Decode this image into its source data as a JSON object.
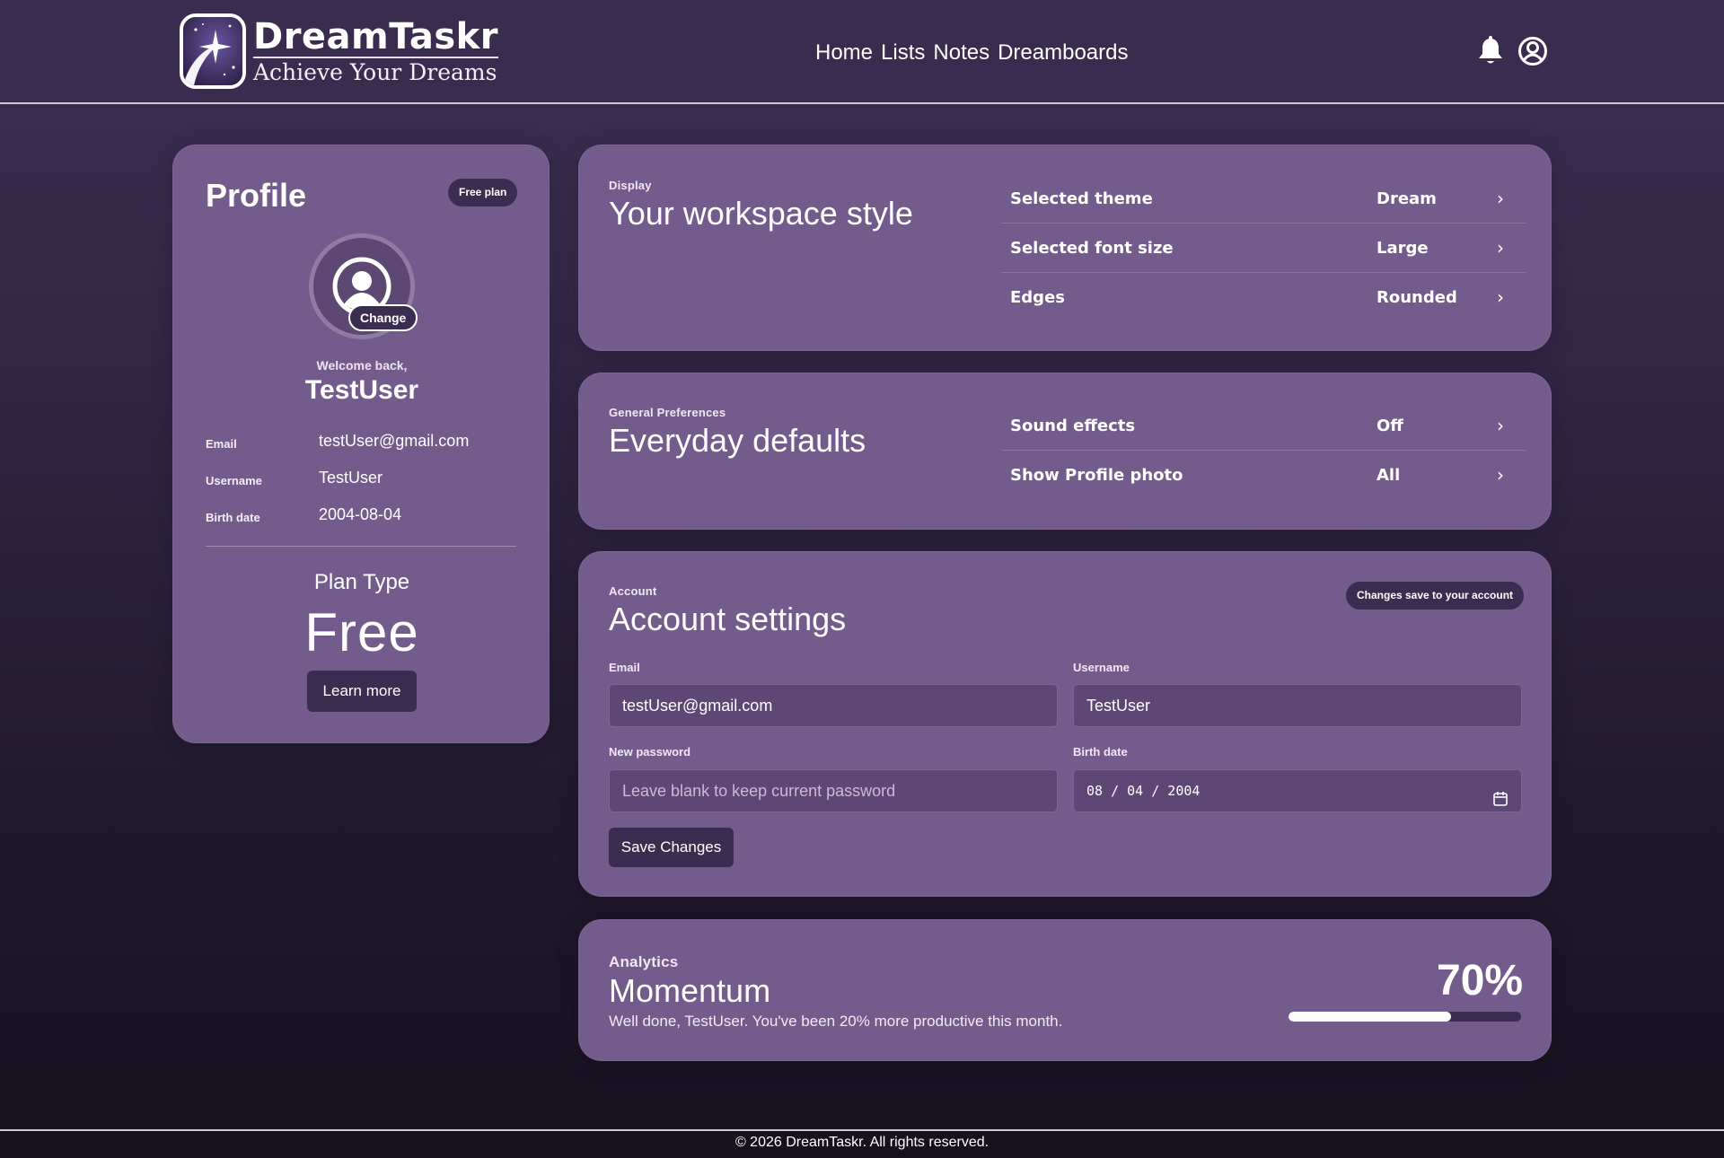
{
  "brand": {
    "name": "DreamTaskr",
    "tagline": "Achieve Your Dreams"
  },
  "nav": {
    "items": [
      "Home",
      "Lists",
      "Notes",
      "Dreamboards"
    ]
  },
  "header_icons": [
    "bell-icon",
    "user-circle-icon"
  ],
  "profile": {
    "heading": "Profile",
    "plan_badge": "Free plan",
    "change_label": "Change",
    "welcome": "Welcome back,",
    "username": "TestUser",
    "fields": [
      {
        "label": "Email",
        "value": "testUser@gmail.com"
      },
      {
        "label": "Username",
        "value": "TestUser"
      },
      {
        "label": "Birth date",
        "value": "2004-08-04"
      }
    ],
    "plan_label": "Plan Type",
    "plan_value": "Free",
    "learn_more": "Learn more"
  },
  "display": {
    "eyebrow": "Display",
    "title": "Your workspace style",
    "rows": [
      {
        "name": "Selected theme",
        "value": "Dream"
      },
      {
        "name": "Selected font size",
        "value": "Large"
      },
      {
        "name": "Edges",
        "value": "Rounded"
      }
    ]
  },
  "preferences": {
    "eyebrow": "General Preferences",
    "title": "Everyday defaults",
    "rows": [
      {
        "name": "Sound effects",
        "value": "Off"
      },
      {
        "name": "Show Profile photo",
        "value": "All"
      }
    ]
  },
  "account": {
    "eyebrow": "Account",
    "title": "Account settings",
    "badge": "Changes save to your account",
    "email_label": "Email",
    "email_value": "testUser@gmail.com",
    "username_label": "Username",
    "username_value": "TestUser",
    "password_label": "New password",
    "password_placeholder": "Leave blank to keep current password",
    "birth_label": "Birth date",
    "birth_value": "08 / 04 / 2004",
    "save_label": "Save Changes"
  },
  "analytics": {
    "eyebrow": "Analytics",
    "title": "Momentum",
    "message": "Well done, TestUser. You've been 20% more productive this month.",
    "percent_label": "70%",
    "progress": 0.7
  },
  "footer": {
    "text": "© 2026 DreamTaskr. All rights reserved."
  },
  "colors": {
    "card": "#735c8b",
    "header": "#3a2c4f",
    "dark_button": "#3b2d4f",
    "input": "#5d4775"
  }
}
